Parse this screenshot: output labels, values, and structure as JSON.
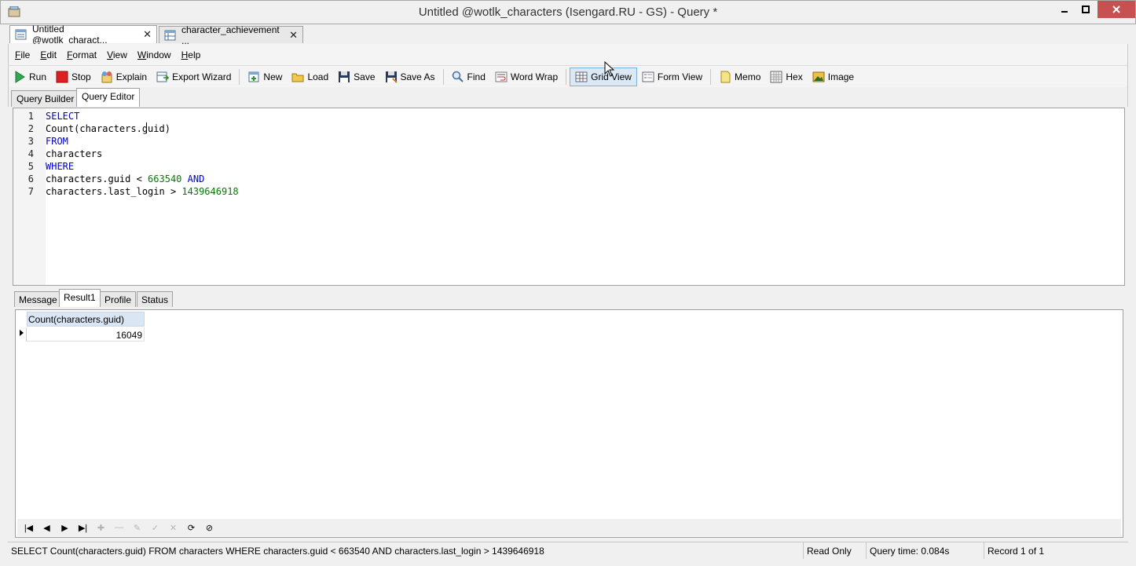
{
  "window": {
    "title": "Untitled @wotlk_characters (Isengard.RU - GS) - Query *"
  },
  "doc_tabs": [
    {
      "label": "Untitled @wotlk_charact...",
      "active": true
    },
    {
      "label": "character_achievement ...",
      "active": false
    }
  ],
  "menu": {
    "file": {
      "mnemonic": "F",
      "rest": "ile"
    },
    "edit": {
      "mnemonic": "E",
      "rest": "dit"
    },
    "format": {
      "mnemonic": "F",
      "rest": "ormat"
    },
    "view": {
      "mnemonic": "V",
      "rest": "iew"
    },
    "window": {
      "mnemonic": "W",
      "rest": "indow"
    },
    "help": {
      "mnemonic": "H",
      "rest": "elp"
    }
  },
  "toolbar": {
    "run": "Run",
    "stop": "Stop",
    "explain": "Explain",
    "export_wizard": "Export Wizard",
    "new": "New",
    "load": "Load",
    "save": "Save",
    "save_as": "Save As",
    "find": "Find",
    "word_wrap": "Word Wrap",
    "grid_view": "Grid View",
    "form_view": "Form View",
    "memo": "Memo",
    "hex": "Hex",
    "image": "Image"
  },
  "editor_tabs": {
    "query_builder": "Query Builder",
    "query_editor": "Query Editor"
  },
  "sql_lines": [
    {
      "n": "1",
      "parts": [
        {
          "t": "SELECT",
          "c": "kw"
        }
      ]
    },
    {
      "n": "2",
      "parts": [
        {
          "t": "Count(characters.guid)",
          "c": ""
        }
      ]
    },
    {
      "n": "3",
      "parts": [
        {
          "t": "FROM",
          "c": "kw"
        }
      ]
    },
    {
      "n": "4",
      "parts": [
        {
          "t": "characters",
          "c": ""
        }
      ]
    },
    {
      "n": "5",
      "parts": [
        {
          "t": "WHERE",
          "c": "kw"
        }
      ]
    },
    {
      "n": "6",
      "parts": [
        {
          "t": "characters.guid < ",
          "c": ""
        },
        {
          "t": "663540",
          "c": "num"
        },
        {
          "t": " ",
          "c": ""
        },
        {
          "t": "AND",
          "c": "kw"
        }
      ]
    },
    {
      "n": "7",
      "parts": [
        {
          "t": "characters.last_login > ",
          "c": ""
        },
        {
          "t": "1439646918",
          "c": "num"
        }
      ]
    }
  ],
  "result_tabs": {
    "message": "Message",
    "result1": "Result1",
    "profile": "Profile",
    "status": "Status"
  },
  "result_grid": {
    "column": "Count(characters.guid)",
    "value": "16049"
  },
  "status_bar": {
    "sql": "SELECT Count(characters.guid) FROM characters WHERE characters.guid < 663540 AND characters.last_login > 1439646918",
    "mode": "Read Only",
    "query_time": "Query time: 0.084s",
    "record": "Record 1 of 1"
  },
  "colors": {
    "keyword": "#0000c8",
    "number": "#008000",
    "close_button": "#c75050",
    "grid_header": "#dae6f3"
  }
}
